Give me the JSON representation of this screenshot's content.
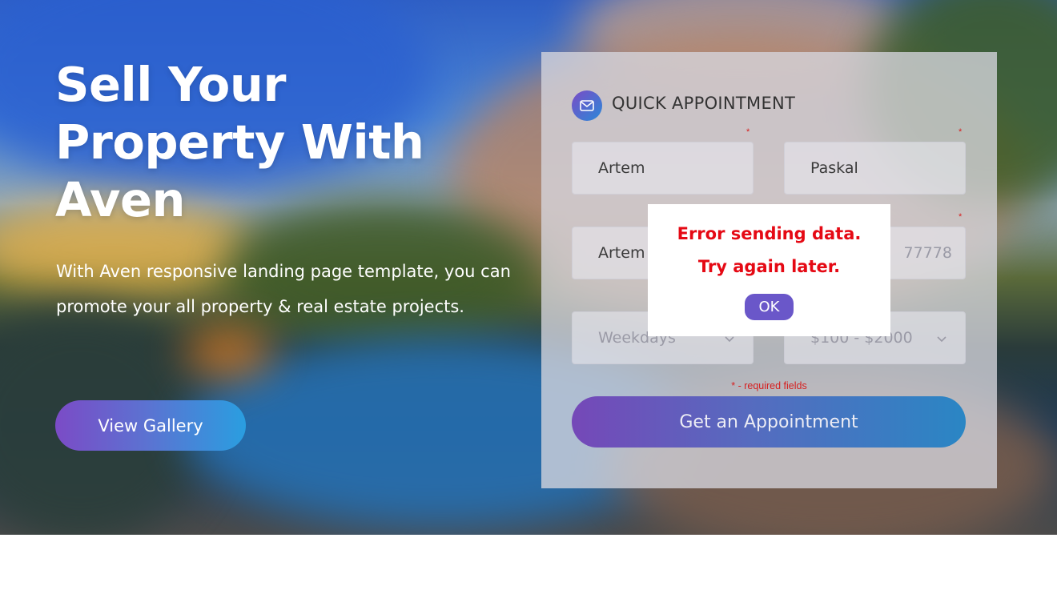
{
  "hero": {
    "title": "Sell Your Property With Aven",
    "subtitle": "With Aven responsive landing page template, you can promote your all property & real estate projects.",
    "gallery_button": "View Gallery"
  },
  "form": {
    "icon": "envelope-icon",
    "title": "QUICK APPOINTMENT",
    "fields": {
      "first_name": {
        "value": "Artem",
        "required_mark": "*"
      },
      "last_name": {
        "value": "Paskal",
        "required_mark": "*"
      },
      "email": {
        "value": "Artem",
        "required_mark": ""
      },
      "phone": {
        "value": "77778",
        "required_mark": "*"
      },
      "day": {
        "value": "Weekdays"
      },
      "budget": {
        "value": "$100 - $2000"
      }
    },
    "required_note": "* - required fields",
    "submit_label": "Get an Appointment"
  },
  "modal": {
    "line1": "Error sending data.",
    "line2": "Try again later.",
    "ok_label": "OK"
  },
  "colors": {
    "accent_purple": "#7b4bc6",
    "accent_blue": "#2a9ee0",
    "error_red": "#e50914",
    "ok_button": "#6a57c9"
  }
}
